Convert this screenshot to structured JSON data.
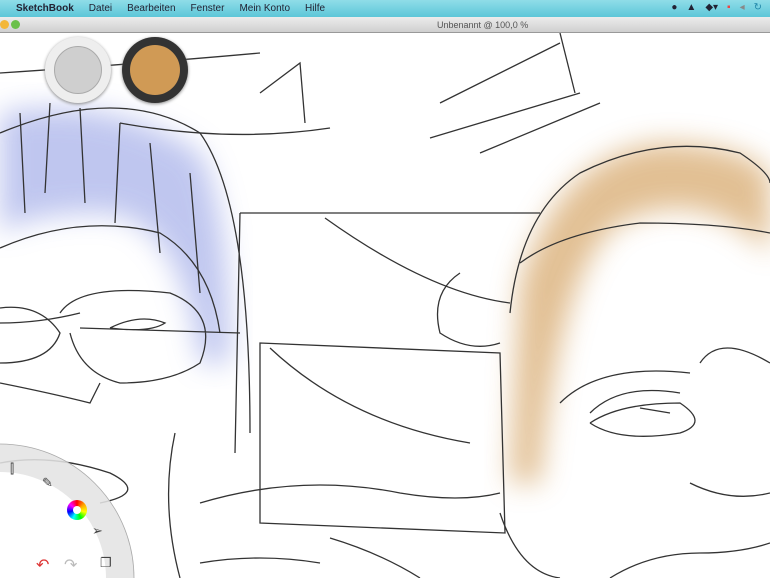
{
  "menubar": {
    "app": "SketchBook",
    "items": [
      "Datei",
      "Bearbeiten",
      "Fenster",
      "Mein Konto",
      "Hilfe"
    ]
  },
  "window": {
    "title": "Unbenannt @ 100,0 %"
  },
  "colors": {
    "primary": "#d09a55",
    "secondary": "#cfcfcf",
    "hair_left": "#aab4ea",
    "hair_right": "#d8aa70"
  },
  "lagoon": {
    "tools": [
      "layers-icon",
      "brush-icon",
      "color-wheel-icon",
      "select-icon",
      "copy-icon",
      "undo-icon",
      "redo-icon"
    ]
  }
}
